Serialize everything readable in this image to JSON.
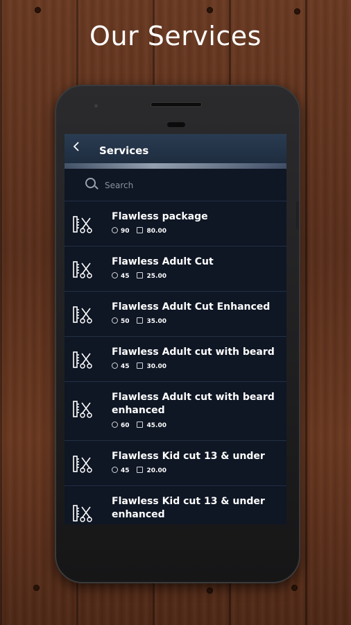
{
  "headline": "Our Services",
  "app": {
    "title": "Services",
    "search_placeholder": "Search"
  },
  "icons": {
    "back": "chevron-left-icon",
    "search": "search-icon",
    "service": "comb-scissors-icon",
    "duration": "clock-icon",
    "price": "price-tag-icon"
  },
  "services": [
    {
      "name": "Flawless package",
      "duration": "90",
      "price": "80.00"
    },
    {
      "name": "Flawless Adult Cut",
      "duration": "45",
      "price": "25.00"
    },
    {
      "name": "Flawless Adult Cut Enhanced",
      "duration": "50",
      "price": "35.00"
    },
    {
      "name": "Flawless Adult cut with beard",
      "duration": "45",
      "price": "30.00"
    },
    {
      "name": "Flawless Adult cut with beard enhanced",
      "duration": "60",
      "price": "45.00"
    },
    {
      "name": "Flawless Kid cut 13 & under",
      "duration": "45",
      "price": "20.00"
    },
    {
      "name": "Flawless Kid cut 13 & under enhanced",
      "duration": "",
      "price": ""
    }
  ]
}
